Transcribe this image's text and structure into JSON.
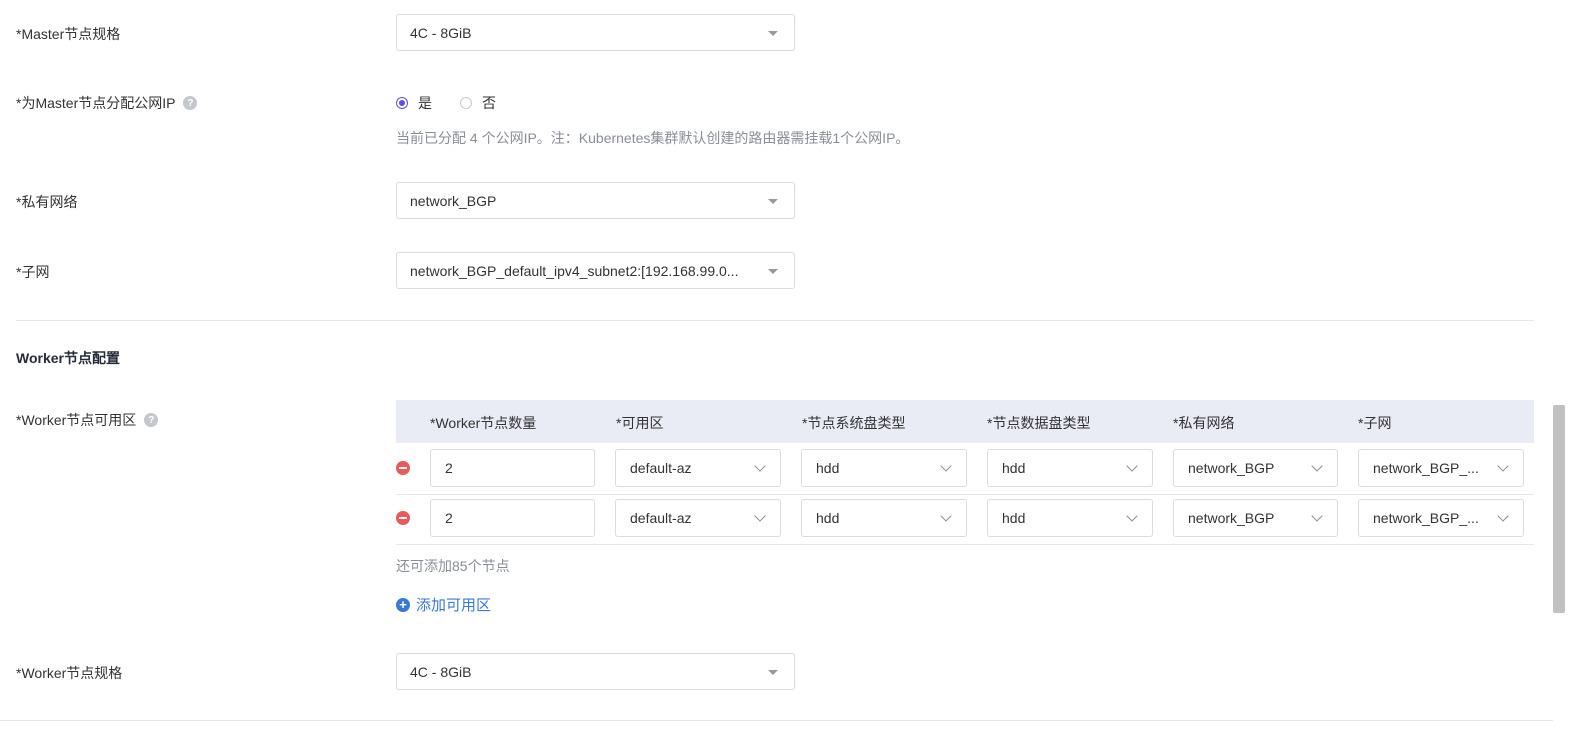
{
  "master": {
    "spec_label": "*Master节点规格",
    "spec_value": "4C - 8GiB",
    "public_ip_label": "*为Master节点分配公网IP",
    "public_ip_options": [
      "是",
      "否"
    ],
    "public_ip_selected": "是",
    "public_ip_hint": "当前已分配 4 个公网IP。注：Kubernetes集群默认创建的路由器需挂载1个公网IP。",
    "network_label": "*私有网络",
    "network_value": "network_BGP",
    "subnet_label": "*子网",
    "subnet_value": "network_BGP_default_ipv4_subnet2:[192.168.99.0..."
  },
  "worker": {
    "section_title": "Worker节点配置",
    "az_label": "*Worker节点可用区",
    "columns": [
      "*Worker节点数量",
      "*可用区",
      "*节点系统盘类型",
      "*节点数据盘类型",
      "*私有网络",
      "*子网"
    ],
    "rows": [
      {
        "count": "2",
        "az": "default-az",
        "sys_disk": "hdd",
        "data_disk": "hdd",
        "network": "network_BGP",
        "subnet": "network_BGP_..."
      },
      {
        "count": "2",
        "az": "default-az",
        "sys_disk": "hdd",
        "data_disk": "hdd",
        "network": "network_BGP",
        "subnet": "network_BGP_..."
      }
    ],
    "remaining_hint": "还可添加85个节点",
    "add_zone_label": "添加可用区",
    "spec_label": "*Worker节点规格",
    "spec_value": "4C - 8GiB"
  },
  "colors": {
    "accent": "#5d4ee8",
    "link": "#3a78d8",
    "danger": "#ea5a5a",
    "header_bg": "#e9ecf5"
  },
  "icons": [
    "question-icon",
    "minus-circle-icon",
    "plus-circle-icon",
    "caret-down-icon",
    "chevron-down-icon"
  ]
}
